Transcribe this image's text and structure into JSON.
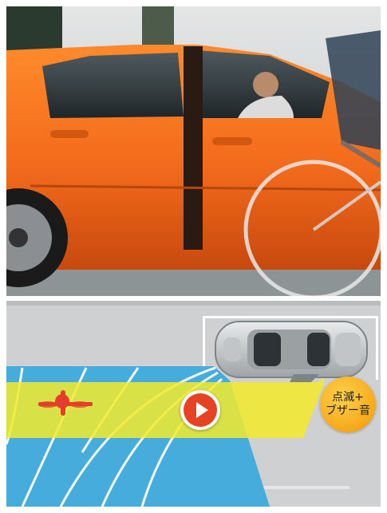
{
  "alert_badge": {
    "line1": "点滅+",
    "line2": "ブザー音"
  },
  "colors": {
    "car_body": "#f26a1b",
    "detection_zone": "#f2ea2a",
    "sensor_area": "#39a8dc",
    "cyclist_marker": "#e53d2c",
    "play_button": "#e64322",
    "badge": "#f6a91a",
    "road": "#cfd0d1"
  },
  "icons": {
    "play": "play-icon",
    "cyclist": "cyclist-icon",
    "car_topdown": "car-top-view-icon"
  }
}
